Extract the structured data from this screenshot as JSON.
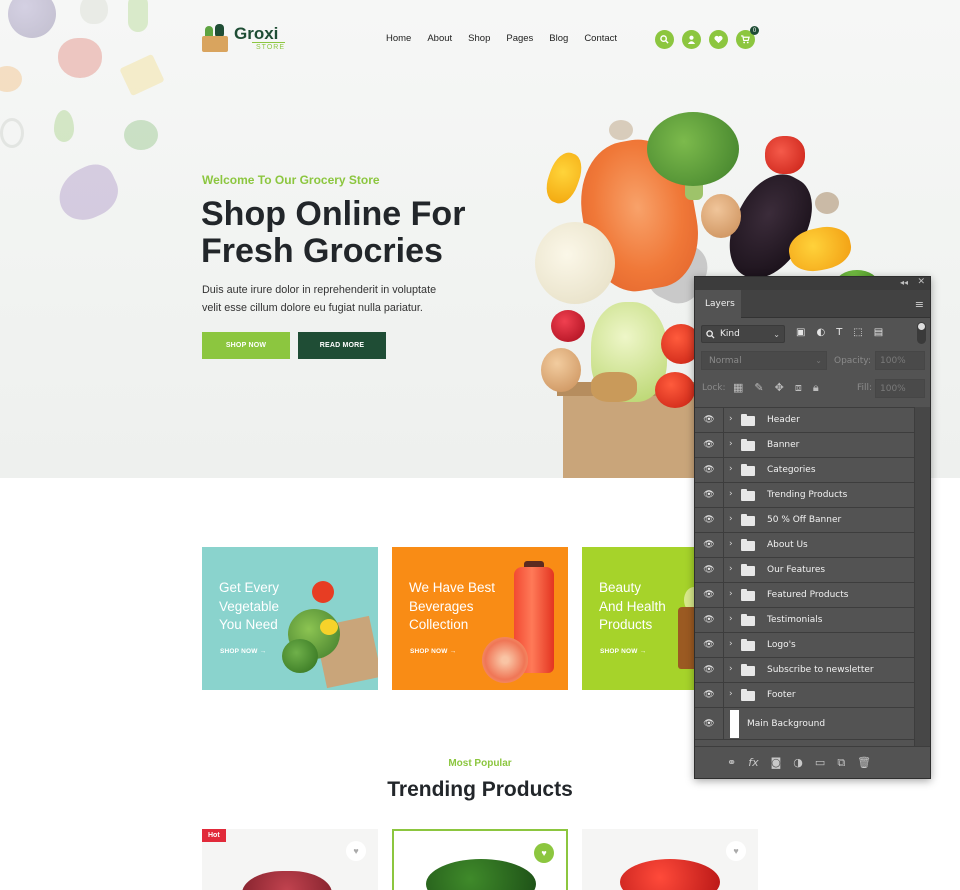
{
  "brand": {
    "name": "Groxi",
    "sub": "STORE"
  },
  "nav": [
    "Home",
    "About",
    "Shop",
    "Pages",
    "Blog",
    "Contact"
  ],
  "header_icons": [
    "search-icon",
    "user-icon",
    "heart-icon",
    "cart-icon"
  ],
  "cart_count": "0",
  "hero": {
    "subtitle": "Welcome To Our Grocery Store",
    "title_line1": "Shop Online For",
    "title_line2": "Fresh Grocries",
    "desc_line1": "Duis aute irure dolor in reprehenderit in voluptate",
    "desc_line2": "velit esse cillum dolore eu fugiat nulla pariatur.",
    "btn_shop": "SHOP NOW",
    "btn_more": "READ MORE"
  },
  "categories": [
    {
      "line1": "Get Every",
      "line2": "Vegetable",
      "line3": "You Need",
      "link": "SHOP NOW →",
      "color": "#8ad3cd"
    },
    {
      "line1": "We Have Best",
      "line2": "Beverages",
      "line3": "Collection",
      "link": "SHOP NOW →",
      "color": "#f98c15"
    },
    {
      "line1": "Beauty",
      "line2": "And Health",
      "line3": "Products",
      "link": "SHOP NOW →",
      "color": "#a6d32a"
    }
  ],
  "trending": {
    "eyebrow": "Most Popular",
    "title": "Trending Products",
    "badge": "Hot"
  },
  "colors": {
    "accent": "#8cc63f",
    "dark": "#1f4d35",
    "hot": "#e12a3a"
  },
  "layers_panel": {
    "tab": "Layers",
    "kind": "Kind",
    "blend": "Normal",
    "opacity_label": "Opacity:",
    "opacity_value": "100%",
    "lock_label": "Lock:",
    "fill_label": "Fill:",
    "fill_value": "100%",
    "groups": [
      "Header",
      "Banner",
      "Categories",
      "Trending Products",
      "50 % Off  Banner",
      "About Us",
      "Our Features",
      "Featured Products",
      "Testimonials",
      "Logo's",
      "Subscribe to newsletter",
      "Footer"
    ],
    "background_layer": "Main Background"
  }
}
